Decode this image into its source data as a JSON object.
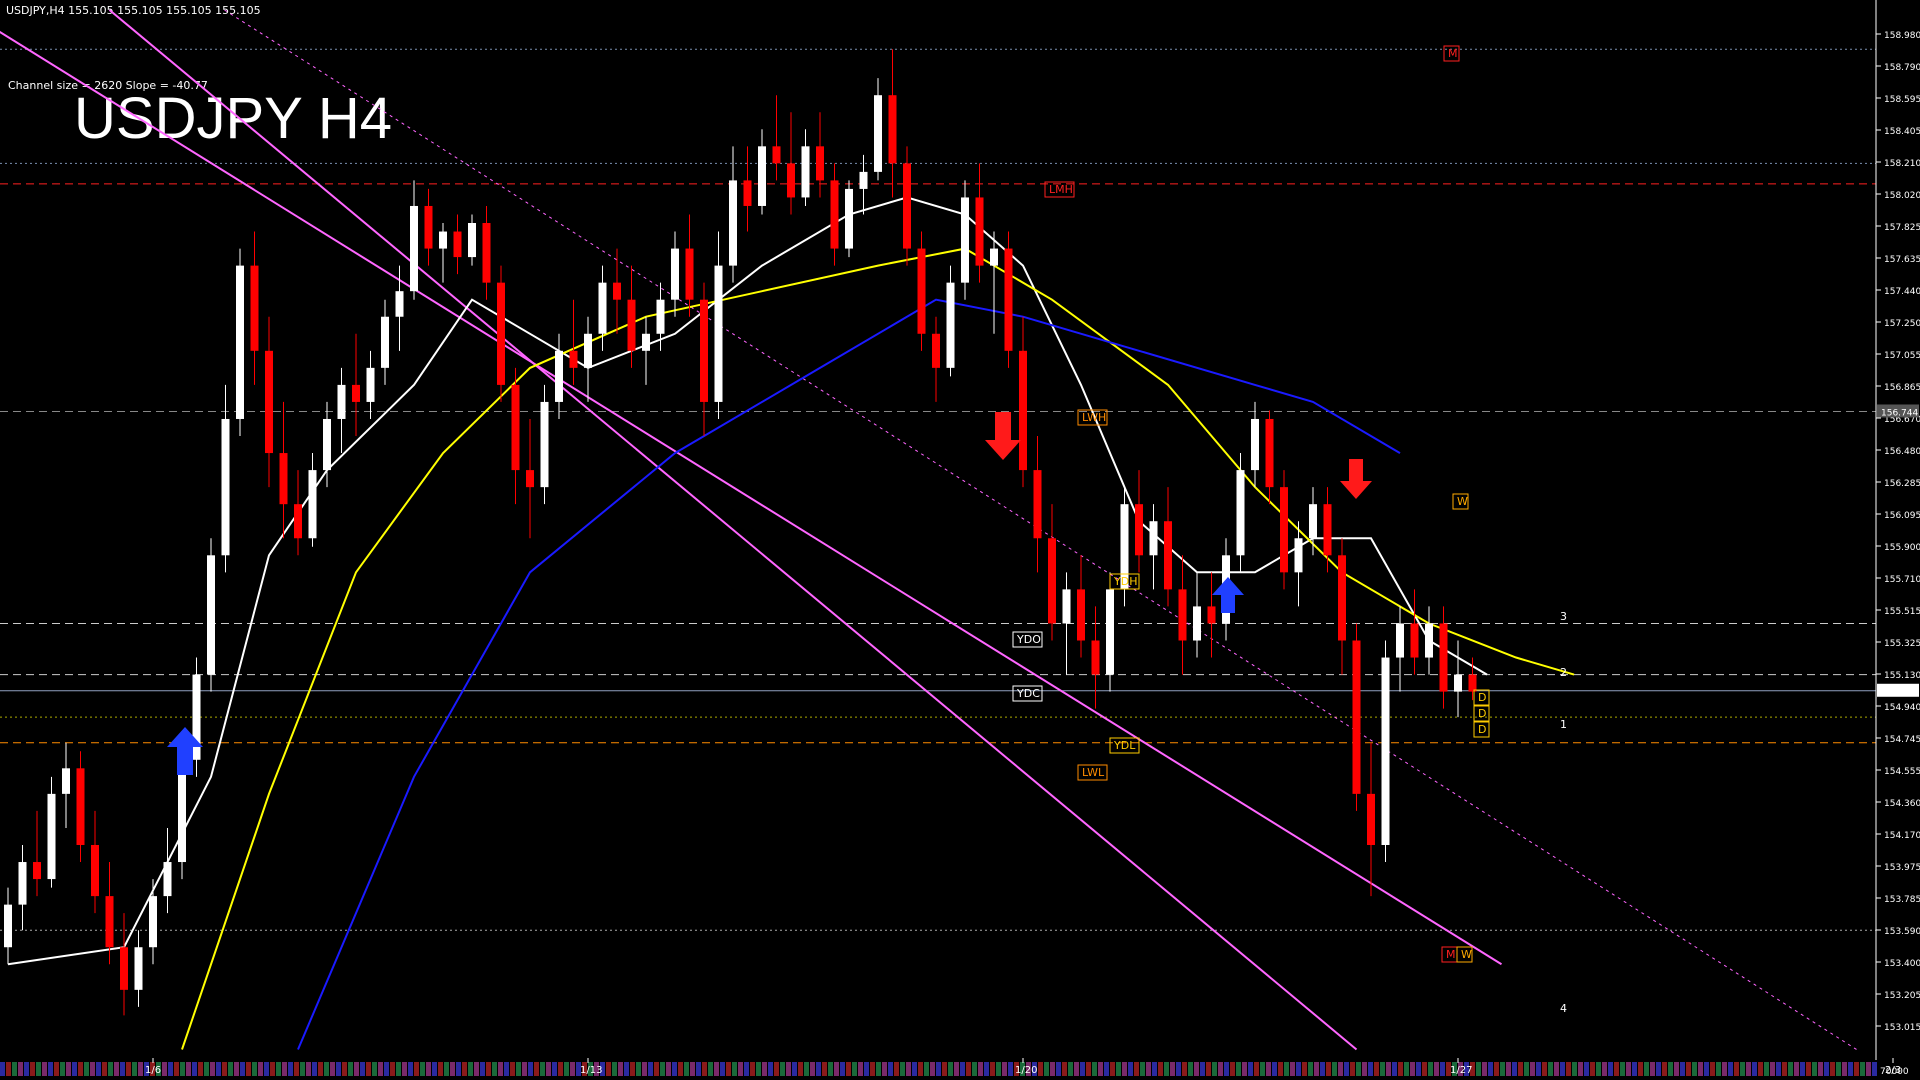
{
  "header": {
    "symbol_line": "USDJPY,H4   155.105 155.105 155.105 155.105",
    "channel_info": "Channel size = 2620 Slope = -40.77",
    "big_title": "USDJPY H4"
  },
  "colors": {
    "background": "#000000",
    "bull_candle": "#ffffff",
    "bear_candle": "#ff0000",
    "ma_white": "#ffffff",
    "ma_yellow": "#ffff00",
    "ma_blue": "#1a1aff",
    "channel": "#ff66ff",
    "bollinger": "#cc0000",
    "green_osc": "#22bb22",
    "cloud": "#2a3cff"
  },
  "chart_data": {
    "type": "candlestick",
    "symbol": "USDJPY",
    "timeframe": "H4",
    "ylim": [
      152.95,
      159.1
    ],
    "y_ticks": [
      "158.980",
      "158.790",
      "158.595",
      "158.405",
      "158.210",
      "158.020",
      "157.825",
      "157.635",
      "157.440",
      "157.250",
      "157.055",
      "156.865",
      "156.670",
      "156.480",
      "156.285",
      "156.095",
      "155.900",
      "155.710",
      "155.515",
      "155.325",
      "155.130",
      "154.940",
      "154.745",
      "154.555",
      "154.360",
      "154.170",
      "153.975",
      "153.785",
      "153.590",
      "153.400",
      "153.205",
      "153.015"
    ],
    "x_labels": [
      {
        "label": "1/6",
        "bar": 10
      },
      {
        "label": "1/13",
        "bar": 40
      },
      {
        "label": "1/20",
        "bar": 70
      },
      {
        "label": "1/27",
        "bar": 100
      },
      {
        "label": "2/3",
        "bar": 130
      }
    ],
    "current_price": "155.105",
    "marked_price": "156.744",
    "candles": [
      [
        153.6,
        153.95,
        153.5,
        153.85
      ],
      [
        153.85,
        154.2,
        153.7,
        154.1
      ],
      [
        154.1,
        154.4,
        153.9,
        154.0
      ],
      [
        154.0,
        154.6,
        153.95,
        154.5
      ],
      [
        154.5,
        154.8,
        154.3,
        154.65
      ],
      [
        154.65,
        154.75,
        154.1,
        154.2
      ],
      [
        154.2,
        154.4,
        153.8,
        153.9
      ],
      [
        153.9,
        154.1,
        153.5,
        153.6
      ],
      [
        153.6,
        153.8,
        153.2,
        153.35
      ],
      [
        153.35,
        153.7,
        153.25,
        153.6
      ],
      [
        153.6,
        154.0,
        153.5,
        153.9
      ],
      [
        153.9,
        154.3,
        153.8,
        154.1
      ],
      [
        154.1,
        154.8,
        154.0,
        154.7
      ],
      [
        154.7,
        155.3,
        154.6,
        155.2
      ],
      [
        155.2,
        156.0,
        155.1,
        155.9
      ],
      [
        155.9,
        156.9,
        155.8,
        156.7
      ],
      [
        156.7,
        157.7,
        156.6,
        157.6
      ],
      [
        157.6,
        157.8,
        156.9,
        157.1
      ],
      [
        157.1,
        157.3,
        156.3,
        156.5
      ],
      [
        156.5,
        156.8,
        156.0,
        156.2
      ],
      [
        156.2,
        156.4,
        155.9,
        156.0
      ],
      [
        156.0,
        156.5,
        155.95,
        156.4
      ],
      [
        156.4,
        156.8,
        156.3,
        156.7
      ],
      [
        156.7,
        157.0,
        156.5,
        156.9
      ],
      [
        156.9,
        157.2,
        156.6,
        156.8
      ],
      [
        156.8,
        157.1,
        156.7,
        157.0
      ],
      [
        157.0,
        157.4,
        156.9,
        157.3
      ],
      [
        157.3,
        157.6,
        157.1,
        157.45
      ],
      [
        157.45,
        158.1,
        157.4,
        157.95
      ],
      [
        157.95,
        158.05,
        157.6,
        157.7
      ],
      [
        157.7,
        157.85,
        157.5,
        157.8
      ],
      [
        157.8,
        157.9,
        157.55,
        157.65
      ],
      [
        157.65,
        157.9,
        157.6,
        157.85
      ],
      [
        157.85,
        157.95,
        157.4,
        157.5
      ],
      [
        157.5,
        157.6,
        156.8,
        156.9
      ],
      [
        156.9,
        157.0,
        156.2,
        156.4
      ],
      [
        156.4,
        156.7,
        156.0,
        156.3
      ],
      [
        156.3,
        156.9,
        156.2,
        156.8
      ],
      [
        156.8,
        157.2,
        156.7,
        157.1
      ],
      [
        157.1,
        157.4,
        156.9,
        157.0
      ],
      [
        157.0,
        157.3,
        156.8,
        157.2
      ],
      [
        157.2,
        157.6,
        157.1,
        157.5
      ],
      [
        157.5,
        157.7,
        157.2,
        157.4
      ],
      [
        157.4,
        157.6,
        157.0,
        157.1
      ],
      [
        157.1,
        157.3,
        156.9,
        157.2
      ],
      [
        157.2,
        157.5,
        157.1,
        157.4
      ],
      [
        157.4,
        157.8,
        157.3,
        157.7
      ],
      [
        157.7,
        157.9,
        157.3,
        157.4
      ],
      [
        157.4,
        157.5,
        156.6,
        156.8
      ],
      [
        156.8,
        157.8,
        156.7,
        157.6
      ],
      [
        157.6,
        158.3,
        157.5,
        158.1
      ],
      [
        158.1,
        158.3,
        157.8,
        157.95
      ],
      [
        157.95,
        158.4,
        157.9,
        158.3
      ],
      [
        158.3,
        158.6,
        158.1,
        158.2
      ],
      [
        158.2,
        158.5,
        157.9,
        158.0
      ],
      [
        158.0,
        158.4,
        157.95,
        158.3
      ],
      [
        158.3,
        158.5,
        158.0,
        158.1
      ],
      [
        158.1,
        158.2,
        157.6,
        157.7
      ],
      [
        157.7,
        158.1,
        157.65,
        158.05
      ],
      [
        158.05,
        158.25,
        157.9,
        158.15
      ],
      [
        158.15,
        158.7,
        158.1,
        158.6
      ],
      [
        158.6,
        158.87,
        158.0,
        158.2
      ],
      [
        158.2,
        158.3,
        157.6,
        157.7
      ],
      [
        157.7,
        157.8,
        157.1,
        157.2
      ],
      [
        157.2,
        157.3,
        156.8,
        157.0
      ],
      [
        157.0,
        157.6,
        156.95,
        157.5
      ],
      [
        157.5,
        158.1,
        157.4,
        158.0
      ],
      [
        158.0,
        158.2,
        157.5,
        157.6
      ],
      [
        157.6,
        157.8,
        157.2,
        157.7
      ],
      [
        157.7,
        157.8,
        157.0,
        157.1
      ],
      [
        157.1,
        157.3,
        156.3,
        156.4
      ],
      [
        156.4,
        156.6,
        155.8,
        156.0
      ],
      [
        156.0,
        156.2,
        155.4,
        155.5
      ],
      [
        155.5,
        155.8,
        155.2,
        155.7
      ],
      [
        155.7,
        155.9,
        155.3,
        155.4
      ],
      [
        155.4,
        155.6,
        155.0,
        155.2
      ],
      [
        155.2,
        155.8,
        155.1,
        155.7
      ],
      [
        155.7,
        156.3,
        155.6,
        156.2
      ],
      [
        156.2,
        156.4,
        155.8,
        155.9
      ],
      [
        155.9,
        156.2,
        155.7,
        156.1
      ],
      [
        156.1,
        156.3,
        155.6,
        155.7
      ],
      [
        155.7,
        155.9,
        155.2,
        155.4
      ],
      [
        155.4,
        155.8,
        155.3,
        155.6
      ],
      [
        155.6,
        155.8,
        155.3,
        155.5
      ],
      [
        155.5,
        156.0,
        155.4,
        155.9
      ],
      [
        155.9,
        156.5,
        155.8,
        156.4
      ],
      [
        156.4,
        156.8,
        156.3,
        156.7
      ],
      [
        156.7,
        156.75,
        156.2,
        156.3
      ],
      [
        156.3,
        156.4,
        155.7,
        155.8
      ],
      [
        155.8,
        156.1,
        155.6,
        156.0
      ],
      [
        156.0,
        156.3,
        155.9,
        156.2
      ],
      [
        156.2,
        156.3,
        155.8,
        155.9
      ],
      [
        155.9,
        156.0,
        155.2,
        155.4
      ],
      [
        155.4,
        155.5,
        154.4,
        154.5
      ],
      [
        154.5,
        154.8,
        153.9,
        154.2
      ],
      [
        154.2,
        155.4,
        154.1,
        155.3
      ],
      [
        155.3,
        155.6,
        155.1,
        155.5
      ],
      [
        155.5,
        155.7,
        155.2,
        155.3
      ],
      [
        155.3,
        155.6,
        155.2,
        155.5
      ],
      [
        155.5,
        155.6,
        155.0,
        155.1
      ],
      [
        155.1,
        155.4,
        154.95,
        155.2
      ],
      [
        155.2,
        155.3,
        155.05,
        155.1
      ]
    ],
    "ma_white": [
      [
        0,
        153.5
      ],
      [
        8,
        153.6
      ],
      [
        14,
        154.6
      ],
      [
        18,
        155.9
      ],
      [
        22,
        156.4
      ],
      [
        28,
        156.9
      ],
      [
        32,
        157.4
      ],
      [
        36,
        157.2
      ],
      [
        40,
        157.0
      ],
      [
        46,
        157.2
      ],
      [
        52,
        157.6
      ],
      [
        58,
        157.9
      ],
      [
        62,
        158.0
      ],
      [
        66,
        157.9
      ],
      [
        70,
        157.6
      ],
      [
        74,
        156.9
      ],
      [
        78,
        156.1
      ],
      [
        82,
        155.8
      ],
      [
        86,
        155.8
      ],
      [
        90,
        156.0
      ],
      [
        94,
        156.0
      ],
      [
        98,
        155.4
      ],
      [
        102,
        155.2
      ]
    ],
    "ma_yellow": [
      [
        12,
        153.0
      ],
      [
        18,
        154.5
      ],
      [
        24,
        155.8
      ],
      [
        30,
        156.5
      ],
      [
        36,
        157.0
      ],
      [
        44,
        157.3
      ],
      [
        52,
        157.45
      ],
      [
        60,
        157.6
      ],
      [
        66,
        157.7
      ],
      [
        72,
        157.4
      ],
      [
        80,
        156.9
      ],
      [
        86,
        156.3
      ],
      [
        92,
        155.8
      ],
      [
        98,
        155.5
      ],
      [
        104,
        155.3
      ],
      [
        108,
        155.2
      ]
    ],
    "ma_blue": [
      [
        20,
        153.0
      ],
      [
        28,
        154.6
      ],
      [
        36,
        155.8
      ],
      [
        46,
        156.5
      ],
      [
        56,
        157.0
      ],
      [
        64,
        157.4
      ],
      [
        70,
        157.3
      ],
      [
        78,
        157.1
      ],
      [
        86,
        156.9
      ],
      [
        90,
        156.8
      ],
      [
        96,
        156.5
      ]
    ],
    "channel_upper": [
      [
        -3,
        159.1
      ],
      [
        103,
        153.5
      ]
    ],
    "channel_lower": [
      [
        7,
        159.1
      ],
      [
        93,
        153.0
      ]
    ],
    "projection_levels": [
      "1",
      "2",
      "3",
      "4"
    ],
    "level_labels": [
      "M",
      "LMH",
      "LWH",
      "W",
      "YDH",
      "YDO",
      "YDC",
      "YDL",
      "LWL",
      "M",
      "W",
      "D",
      "D",
      "D"
    ],
    "horizontal_levels": [
      {
        "price": 158.87,
        "color": "#7a8fb0",
        "style": "dotted"
      },
      {
        "price": 158.2,
        "color": "#7a8fb0",
        "style": "dotted"
      },
      {
        "price": 158.08,
        "color": "#ff2020",
        "style": "dashed"
      },
      {
        "price": 156.744,
        "color": "#888888",
        "style": "dashed"
      },
      {
        "price": 155.5,
        "color": "#cccccc",
        "style": "dashed"
      },
      {
        "price": 155.2,
        "color": "#cccccc",
        "style": "dashed"
      },
      {
        "price": 154.95,
        "color": "#aaaa00",
        "style": "dotted"
      },
      {
        "price": 154.8,
        "color": "#ff8c00",
        "style": "dashed"
      },
      {
        "price": 153.7,
        "color": "#aaaaaa",
        "style": "dotted"
      },
      {
        "price": 155.105,
        "color": "#8fa0c0",
        "style": "solid"
      }
    ]
  }
}
